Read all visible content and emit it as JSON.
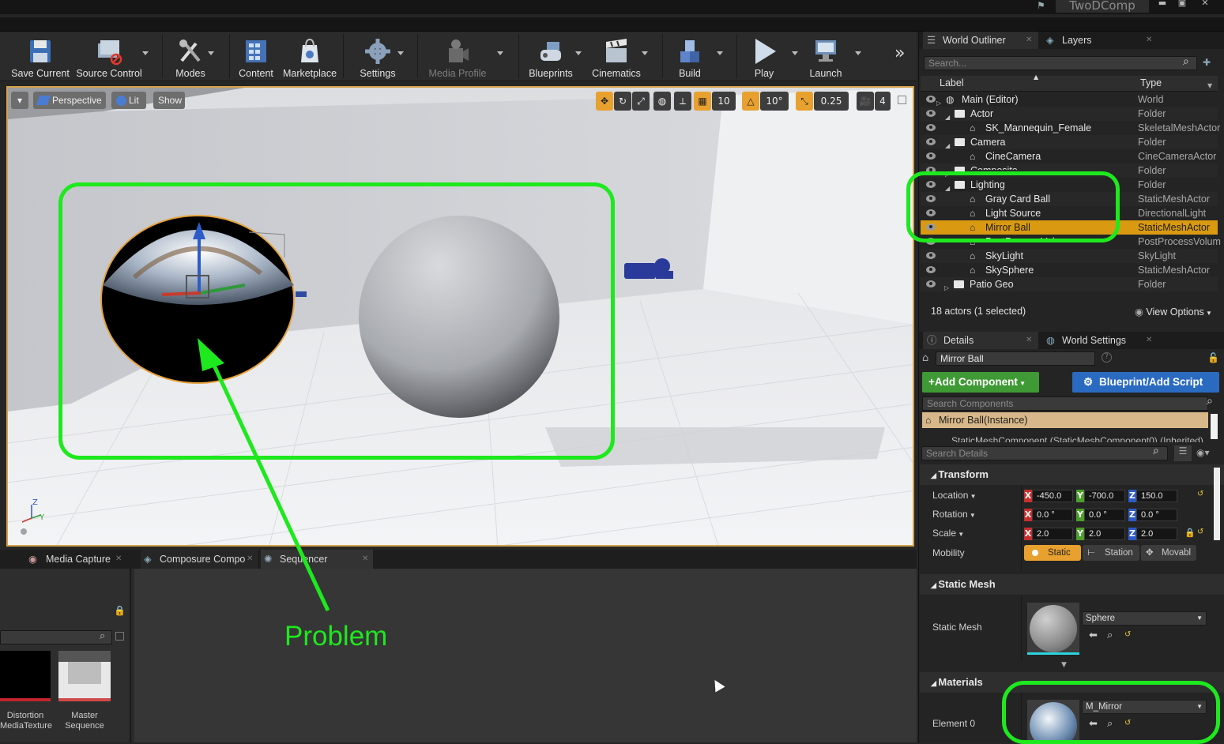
{
  "window": {
    "project": "TwoDComp"
  },
  "toolbar": {
    "items": [
      {
        "label": "Save Current"
      },
      {
        "label": "Source Control"
      },
      {
        "label": "Modes"
      },
      {
        "label": "Content"
      },
      {
        "label": "Marketplace"
      },
      {
        "label": "Settings"
      },
      {
        "label": "Media Profile"
      },
      {
        "label": "Blueprints"
      },
      {
        "label": "Cinematics"
      },
      {
        "label": "Build"
      },
      {
        "label": "Play"
      },
      {
        "label": "Launch"
      }
    ],
    "more": "»"
  },
  "viewport": {
    "perspective": "Perspective",
    "lit": "Lit",
    "show": "Show",
    "grid_snap": "10",
    "rot_snap": "10°",
    "scale_snap": "0.25",
    "cam_speed": "4",
    "axis_z": "Z",
    "axis_y": "Y"
  },
  "annotation": {
    "label": "Problem"
  },
  "dock": {
    "tabs": [
      "Media Capture",
      "Composure Compo",
      "Sequencer"
    ],
    "assets": [
      {
        "label_line1": "Distortion",
        "label_line2": "MediaTexture"
      },
      {
        "label_line1": "Master",
        "label_line2": "Sequence"
      }
    ]
  },
  "outliner": {
    "tabs": [
      "World Outliner",
      "Layers"
    ],
    "search_placeholder": "Search...",
    "col_label": "Label",
    "col_type": "Type",
    "rows": [
      {
        "label": "Main (Editor)",
        "type": "World"
      },
      {
        "label": "Actor",
        "type": "Folder"
      },
      {
        "label": "SK_Mannequin_Female",
        "type": "SkeletalMeshActor"
      },
      {
        "label": "Camera",
        "type": "Folder"
      },
      {
        "label": "CineCamera",
        "type": "CineCameraActor"
      },
      {
        "label": "Composite",
        "type": "Folder"
      },
      {
        "label": "Lighting",
        "type": "Folder"
      },
      {
        "label": "Gray Card Ball",
        "type": "StaticMeshActor"
      },
      {
        "label": "Light Source",
        "type": "DirectionalLight"
      },
      {
        "label": "Mirror Ball",
        "type": "StaticMeshActor"
      },
      {
        "label": "PostProcessVolume",
        "type": "PostProcessVolum"
      },
      {
        "label": "SkyLight",
        "type": "SkyLight"
      },
      {
        "label": "SkySphere",
        "type": "StaticMeshActor"
      },
      {
        "label": "Patio Geo",
        "type": "Folder"
      }
    ],
    "status": "18 actors (1 selected)",
    "view_options": "View Options"
  },
  "details": {
    "tabs": [
      "Details",
      "World Settings"
    ],
    "actor_name": "Mirror Ball",
    "add_component": "Add Component",
    "blueprint": "Blueprint/Add Script",
    "search_components": "Search Components",
    "instance": "Mirror Ball(Instance)",
    "component": "StaticMeshComponent (StaticMeshComponent0) (Inherited)",
    "search_details": "Search Details",
    "transform": {
      "title": "Transform",
      "location_label": "Location",
      "rotation_label": "Rotation",
      "scale_label": "Scale",
      "mobility_label": "Mobility",
      "location": [
        "-450.0",
        "-700.0",
        "150.0"
      ],
      "rotation": [
        "0.0 °",
        "0.0 °",
        "0.0 °"
      ],
      "scale": [
        "2.0",
        "2.0",
        "2.0"
      ],
      "mobility": [
        "Static",
        "Station",
        "Movabl"
      ]
    },
    "static_mesh": {
      "title": "Static Mesh",
      "label": "Static Mesh",
      "value": "Sphere"
    },
    "materials": {
      "title": "Materials",
      "label": "Element 0",
      "value": "M_Mirror"
    }
  },
  "colors": {
    "annotation": "#1ee81e",
    "selection": "#d99a12",
    "accent": "#d4a34a"
  }
}
